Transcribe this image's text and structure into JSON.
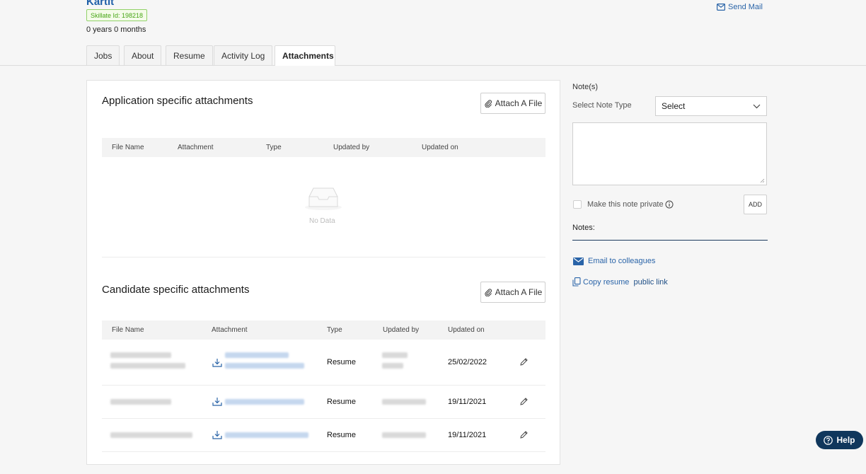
{
  "candidate": {
    "name": "Kartit",
    "skillate_id": "Skillate Id: 198218",
    "experience": "0 years 0 months",
    "send_mail": "Send Mail"
  },
  "tabs": [
    {
      "label": "Jobs",
      "active": false
    },
    {
      "label": "About",
      "active": false
    },
    {
      "label": "Resume",
      "active": false
    },
    {
      "label": "Activity Log",
      "active": false
    },
    {
      "label": "Attachments",
      "active": true
    }
  ],
  "application_attachments": {
    "title": "Application specific attachments",
    "attach_label": "Attach A File",
    "columns": [
      "File Name",
      "Attachment",
      "Type",
      "Updated by",
      "Updated on"
    ],
    "empty_text": "No Data"
  },
  "candidate_attachments": {
    "title": "Candidate specific attachments",
    "attach_label": "Attach A File",
    "columns": [
      "File Name",
      "Attachment",
      "Type",
      "Updated by",
      "Updated on"
    ],
    "rows": [
      {
        "type": "Resume",
        "updated_on": "25/02/2022"
      },
      {
        "type": "Resume",
        "updated_on": "19/11/2021"
      },
      {
        "type": "Resume",
        "updated_on": "19/11/2021"
      }
    ]
  },
  "notes_panel": {
    "heading": "Note(s)",
    "select_type_label": "Select Note Type",
    "select_value": "Select",
    "private_label": "Make this note private",
    "add_label": "ADD",
    "notes_label": "Notes:",
    "email_colleagues": "Email to colleagues",
    "copy_link_prefix": "Copy resume ",
    "copy_link_suffix": "public link"
  },
  "help": {
    "label": "Help"
  },
  "colors": {
    "accent": "#2a64a8",
    "help_bg": "#10375c",
    "badge_green": "#46a515"
  }
}
